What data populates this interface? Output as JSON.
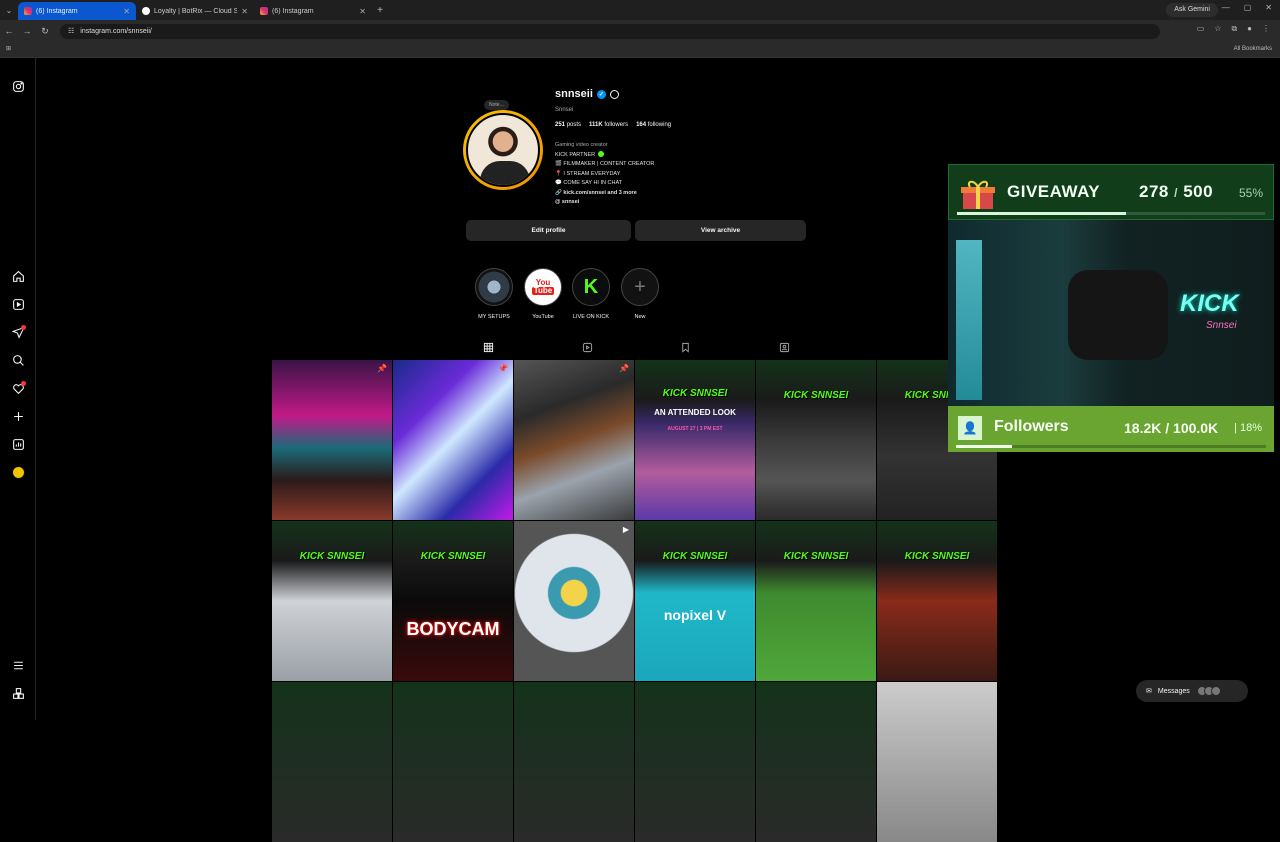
{
  "browser": {
    "tabs": [
      {
        "title": "(6) Instagram",
        "active": true
      },
      {
        "title": "Loyalty | BotRix — Cloud Strea",
        "active": false
      },
      {
        "title": "(6) Instagram",
        "active": false
      }
    ],
    "ask_gemini": "Ask Gemini",
    "url": "instagram.com/snnseii/",
    "all_bookmarks": "All Bookmarks"
  },
  "profile": {
    "username": "snnseii",
    "name": "Snnsei",
    "note": "Note...",
    "stats": {
      "posts": "251",
      "posts_label": "posts",
      "followers": "111K",
      "followers_label": "followers",
      "following": "164",
      "following_label": "following"
    },
    "category": "Gaming video creator",
    "bio_lines": [
      "KICK PARTNER",
      "FILMMAKER | CONTENT CREATOR",
      "I STREAM EVERYDAY",
      "COME SAY HI IN CHAT"
    ],
    "link": "kick.com/snnsei and 3 more",
    "threads": "snnsei",
    "edit_profile": "Edit profile",
    "view_archive": "View archive"
  },
  "highlights": [
    {
      "label": "MY SETUPS",
      "icon": "setup-icon"
    },
    {
      "label": "YouTube",
      "icon": "youtube-icon"
    },
    {
      "label": "LIVE ON KICK",
      "icon": "kick-icon"
    },
    {
      "label": "New",
      "icon": "plus-icon"
    }
  ],
  "grid_text": {
    "kick_brand": "KICK SNNSEI",
    "unattended": "AN ATTENDED LOOK",
    "date": "AUGUST 27 | 3 PM EST",
    "bodycam": "BODYCAM",
    "nopixel": "nopixel V"
  },
  "overlay": {
    "giveaway_title": "GIVEAWAY",
    "giveaway_count": "278",
    "giveaway_total": "500",
    "giveaway_percent": "55%",
    "giveaway_progress": 0.55,
    "followers_title": "Followers",
    "followers_count": "18.2K / 100.0K",
    "followers_percent": "18%",
    "followers_progress": 0.18,
    "cam_neon": "KICK",
    "cam_neon2": "Snnsei"
  },
  "messages_label": "Messages",
  "colors": {
    "kick_green": "#53fc18",
    "ig_blue": "#0095f6",
    "giveaway_bg": "#123d1b",
    "followers_bg": "#6aa431"
  }
}
